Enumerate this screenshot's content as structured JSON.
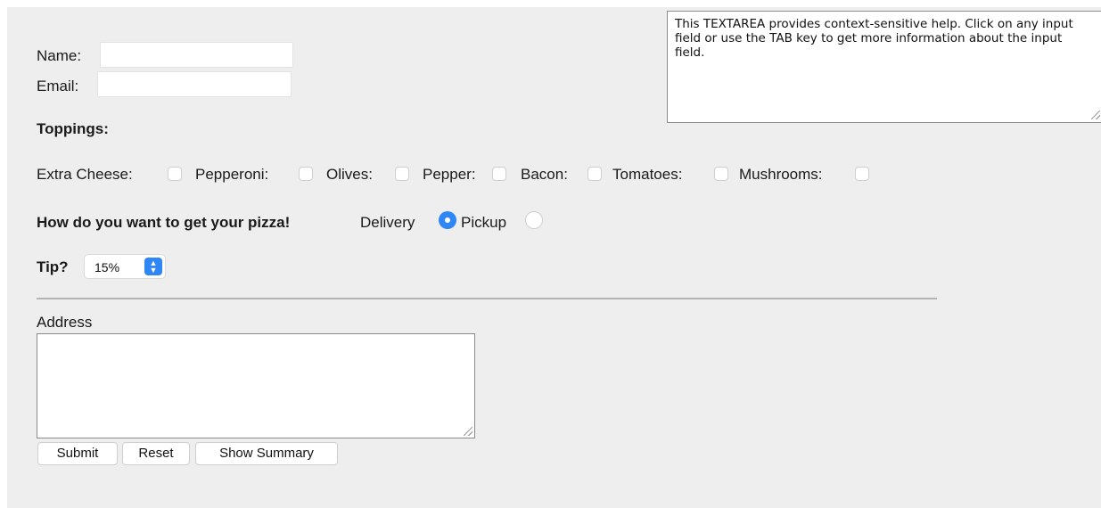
{
  "form": {
    "name_label": "Name:",
    "name_value": "",
    "email_label": "Email:",
    "email_value": "",
    "help_text": "This TEXTAREA provides context-sensitive help. Click on any input field or use the TAB key to get more information about the input field."
  },
  "toppings": {
    "heading": "Toppings:",
    "items": [
      {
        "label": "Extra Cheese:",
        "checked": false
      },
      {
        "label": "Pepperoni:",
        "checked": false
      },
      {
        "label": "Olives:",
        "checked": false
      },
      {
        "label": "Pepper:",
        "checked": false
      },
      {
        "label": "Bacon:",
        "checked": false
      },
      {
        "label": "Tomatoes:",
        "checked": false
      },
      {
        "label": "Mushrooms:",
        "checked": false
      }
    ]
  },
  "delivery": {
    "question": "How do you want to get your pizza!",
    "options": [
      {
        "label": "Delivery",
        "selected": true
      },
      {
        "label": "Pickup",
        "selected": false
      }
    ]
  },
  "tip": {
    "label": "Tip?",
    "selected": "15%"
  },
  "address": {
    "label": "Address",
    "value": ""
  },
  "buttons": {
    "submit": "Submit",
    "reset": "Reset",
    "summary": "Show Summary"
  },
  "colors": {
    "accent": "#2f86f5",
    "background": "#eeeeee"
  }
}
